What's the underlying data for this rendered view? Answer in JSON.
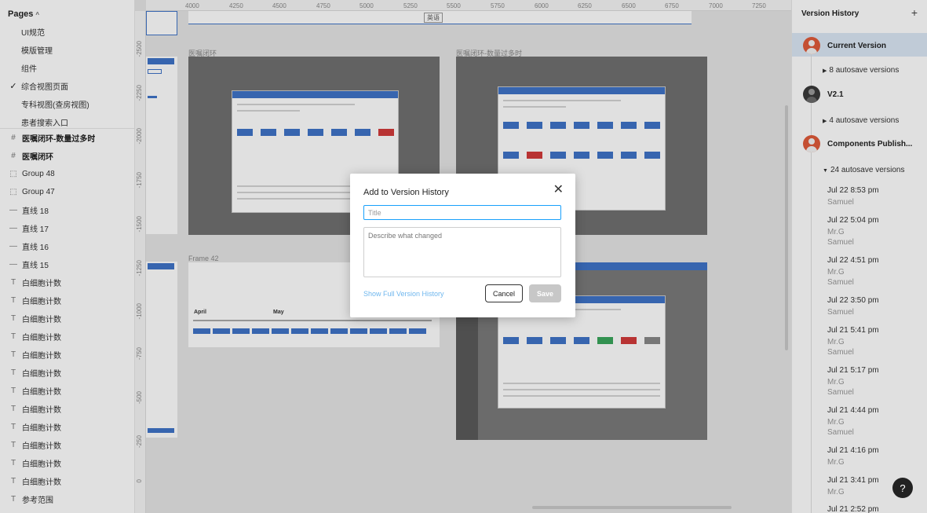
{
  "layers_panel": {
    "pages_header": "Pages",
    "pages": [
      {
        "label": "UI规范",
        "checked": false
      },
      {
        "label": "模版管理",
        "checked": false
      },
      {
        "label": "组件",
        "checked": false
      },
      {
        "label": "综合视图页面",
        "checked": true
      },
      {
        "label": "专科视图(查房视图)",
        "checked": false
      },
      {
        "label": "患者搜索入口",
        "checked": false
      }
    ],
    "layers": [
      {
        "icon": "frame-icon",
        "label": "医嘱闭环-数量过多时",
        "bold": true
      },
      {
        "icon": "frame-icon",
        "label": "医嘱闭环",
        "bold": true
      },
      {
        "icon": "group-icon",
        "label": "Group 48",
        "bold": false
      },
      {
        "icon": "group-icon",
        "label": "Group 47",
        "bold": false
      },
      {
        "icon": "line-icon",
        "label": "直线 18",
        "bold": false
      },
      {
        "icon": "line-icon",
        "label": "直线 17",
        "bold": false
      },
      {
        "icon": "line-icon",
        "label": "直线 16",
        "bold": false
      },
      {
        "icon": "line-icon",
        "label": "直线 15",
        "bold": false
      },
      {
        "icon": "text-icon",
        "label": "白细胞计数",
        "bold": false
      },
      {
        "icon": "text-icon",
        "label": "白细胞计数",
        "bold": false
      },
      {
        "icon": "text-icon",
        "label": "白细胞计数",
        "bold": false
      },
      {
        "icon": "text-icon",
        "label": "白细胞计数",
        "bold": false
      },
      {
        "icon": "text-icon",
        "label": "白细胞计数",
        "bold": false
      },
      {
        "icon": "text-icon",
        "label": "白细胞计数",
        "bold": false
      },
      {
        "icon": "text-icon",
        "label": "白细胞计数",
        "bold": false
      },
      {
        "icon": "text-icon",
        "label": "白细胞计数",
        "bold": false
      },
      {
        "icon": "text-icon",
        "label": "白细胞计数",
        "bold": false
      },
      {
        "icon": "text-icon",
        "label": "白细胞计数",
        "bold": false
      },
      {
        "icon": "text-icon",
        "label": "白细胞计数",
        "bold": false
      },
      {
        "icon": "text-icon",
        "label": "白细胞计数",
        "bold": false
      },
      {
        "icon": "text-icon",
        "label": "参考范围",
        "bold": false
      }
    ]
  },
  "canvas": {
    "ruler_top": [
      "4000",
      "4250",
      "4500",
      "4750",
      "5000",
      "5250",
      "5500",
      "5750",
      "6000",
      "6250",
      "6500",
      "6750",
      "7000",
      "7250"
    ],
    "ruler_left": [
      "-2500",
      "-2250",
      "-2000",
      "-1750",
      "-1500",
      "-1250",
      "-1000",
      "-750",
      "-500",
      "-250",
      "0"
    ],
    "frames": {
      "frame1": "医嘱闭环",
      "frame2": "医嘱闭环-数量过多时",
      "frame3": "Frame 42"
    },
    "top_label": "英语",
    "month_april": "April",
    "month_may": "May"
  },
  "version_history": {
    "title": "Version History",
    "current": {
      "name": "Current Version",
      "autosave": "8 autosave versions"
    },
    "v21": {
      "name": "V2.1",
      "autosave": "4 autosave versions"
    },
    "components": {
      "name": "Components Publish...",
      "autosave": "24 autosave versions"
    },
    "entries": [
      {
        "time": "Jul 22 8:53 pm",
        "authors": [
          "Samuel"
        ]
      },
      {
        "time": "Jul 22 5:04 pm",
        "authors": [
          "Mr.G",
          "Samuel"
        ]
      },
      {
        "time": "Jul 22 4:51 pm",
        "authors": [
          "Mr.G",
          "Samuel"
        ]
      },
      {
        "time": "Jul 22 3:50 pm",
        "authors": [
          "Samuel"
        ]
      },
      {
        "time": "Jul 21 5:41 pm",
        "authors": [
          "Mr.G",
          "Samuel"
        ]
      },
      {
        "time": "Jul 21 5:17 pm",
        "authors": [
          "Mr.G",
          "Samuel"
        ]
      },
      {
        "time": "Jul 21 4:44 pm",
        "authors": [
          "Mr.G",
          "Samuel"
        ]
      },
      {
        "time": "Jul 21 4:16 pm",
        "authors": [
          "Mr.G"
        ]
      },
      {
        "time": "Jul 21 3:41 pm",
        "authors": [
          "Mr.G"
        ]
      },
      {
        "time": "Jul 21 2:52 pm",
        "authors": []
      }
    ]
  },
  "modal": {
    "title": "Add to Version History",
    "title_placeholder": "Title",
    "title_value": "",
    "description_placeholder": "Describe what changed",
    "description_value": "",
    "link": "Show Full Version History",
    "cancel": "Cancel",
    "save": "Save"
  },
  "help": "?"
}
